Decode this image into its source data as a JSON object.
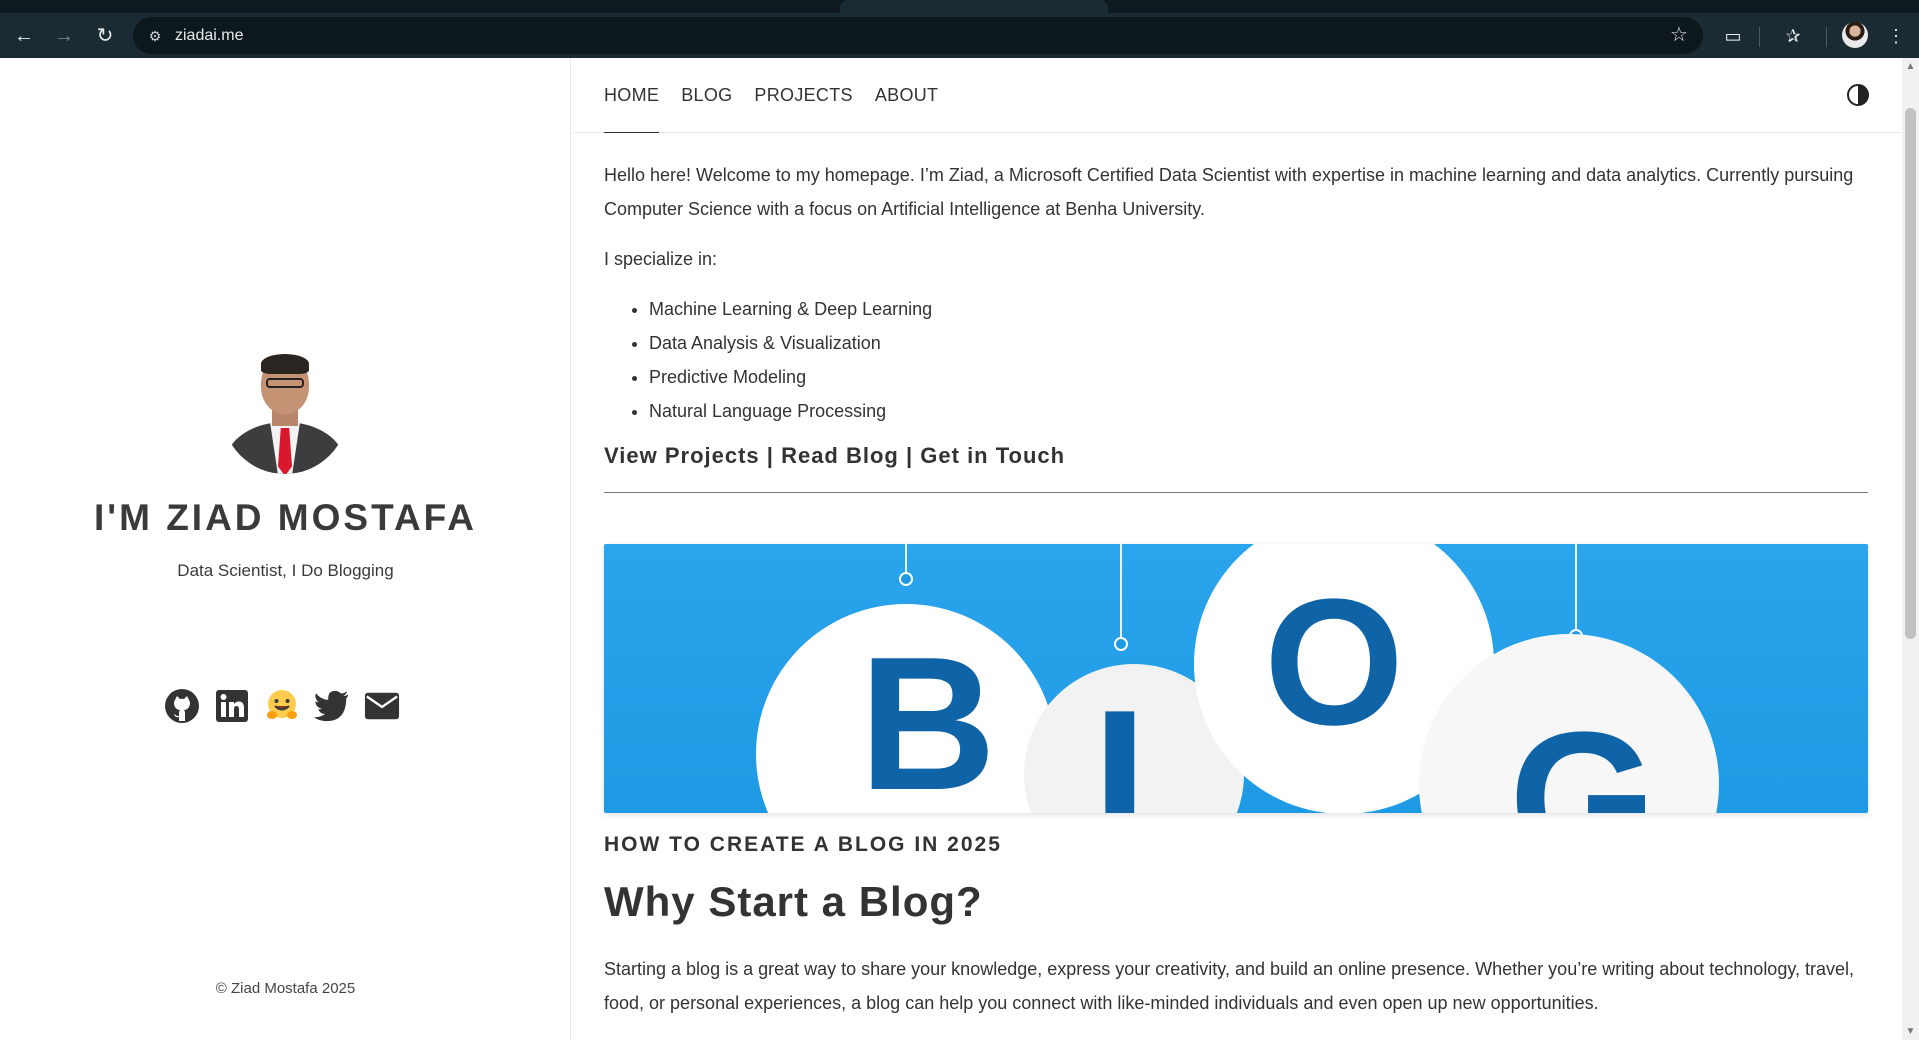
{
  "browser": {
    "url": "ziadai.me"
  },
  "sidebar": {
    "name": "I'M ZIAD MOSTAFA",
    "tagline": "Data Scientist, I Do Blogging",
    "socials": [
      "github-icon",
      "linkedin-icon",
      "huggingface-icon",
      "twitter-icon",
      "envelope-icon"
    ],
    "copyright": "© Ziad Mostafa 2025"
  },
  "nav": {
    "items": [
      {
        "label": "HOME",
        "active": true
      },
      {
        "label": "BLOG"
      },
      {
        "label": "PROJECTS"
      },
      {
        "label": "ABOUT"
      }
    ]
  },
  "main": {
    "intro": "Hello here! Welcome to my homepage. I’m Ziad, a Microsoft Certified Data Scientist with expertise in machine learning and data analytics. Currently pursuing Computer Science with a focus on Artificial Intelligence at Benha University.",
    "specialize_label": "I specialize in:",
    "skills": [
      "Machine Learning & Deep Learning",
      "Data Analysis & Visualization",
      "Predictive Modeling",
      "Natural Language Processing"
    ],
    "cta": {
      "projects": "View Projects",
      "separator": "|",
      "blog": "Read Blog",
      "contact": "Get in Touch"
    },
    "post": {
      "hero_letters": [
        "B",
        "L",
        "O",
        "G"
      ],
      "title": "HOW TO CREATE A BLOG IN 2025",
      "heading": "Why Start a Blog?",
      "body": "Starting a blog is a great way to share your knowledge, express your creativity, and build an online presence. Whether you’re writing about technology, travel, food, or personal experiences, a blog can help you connect with like-minded individuals and even open up new opportunities."
    }
  },
  "colors": {
    "chrome": "#1b2b33",
    "hero_blue": "#1e9ae4",
    "letter_blue": "#0f64a8",
    "text": "#333333"
  }
}
